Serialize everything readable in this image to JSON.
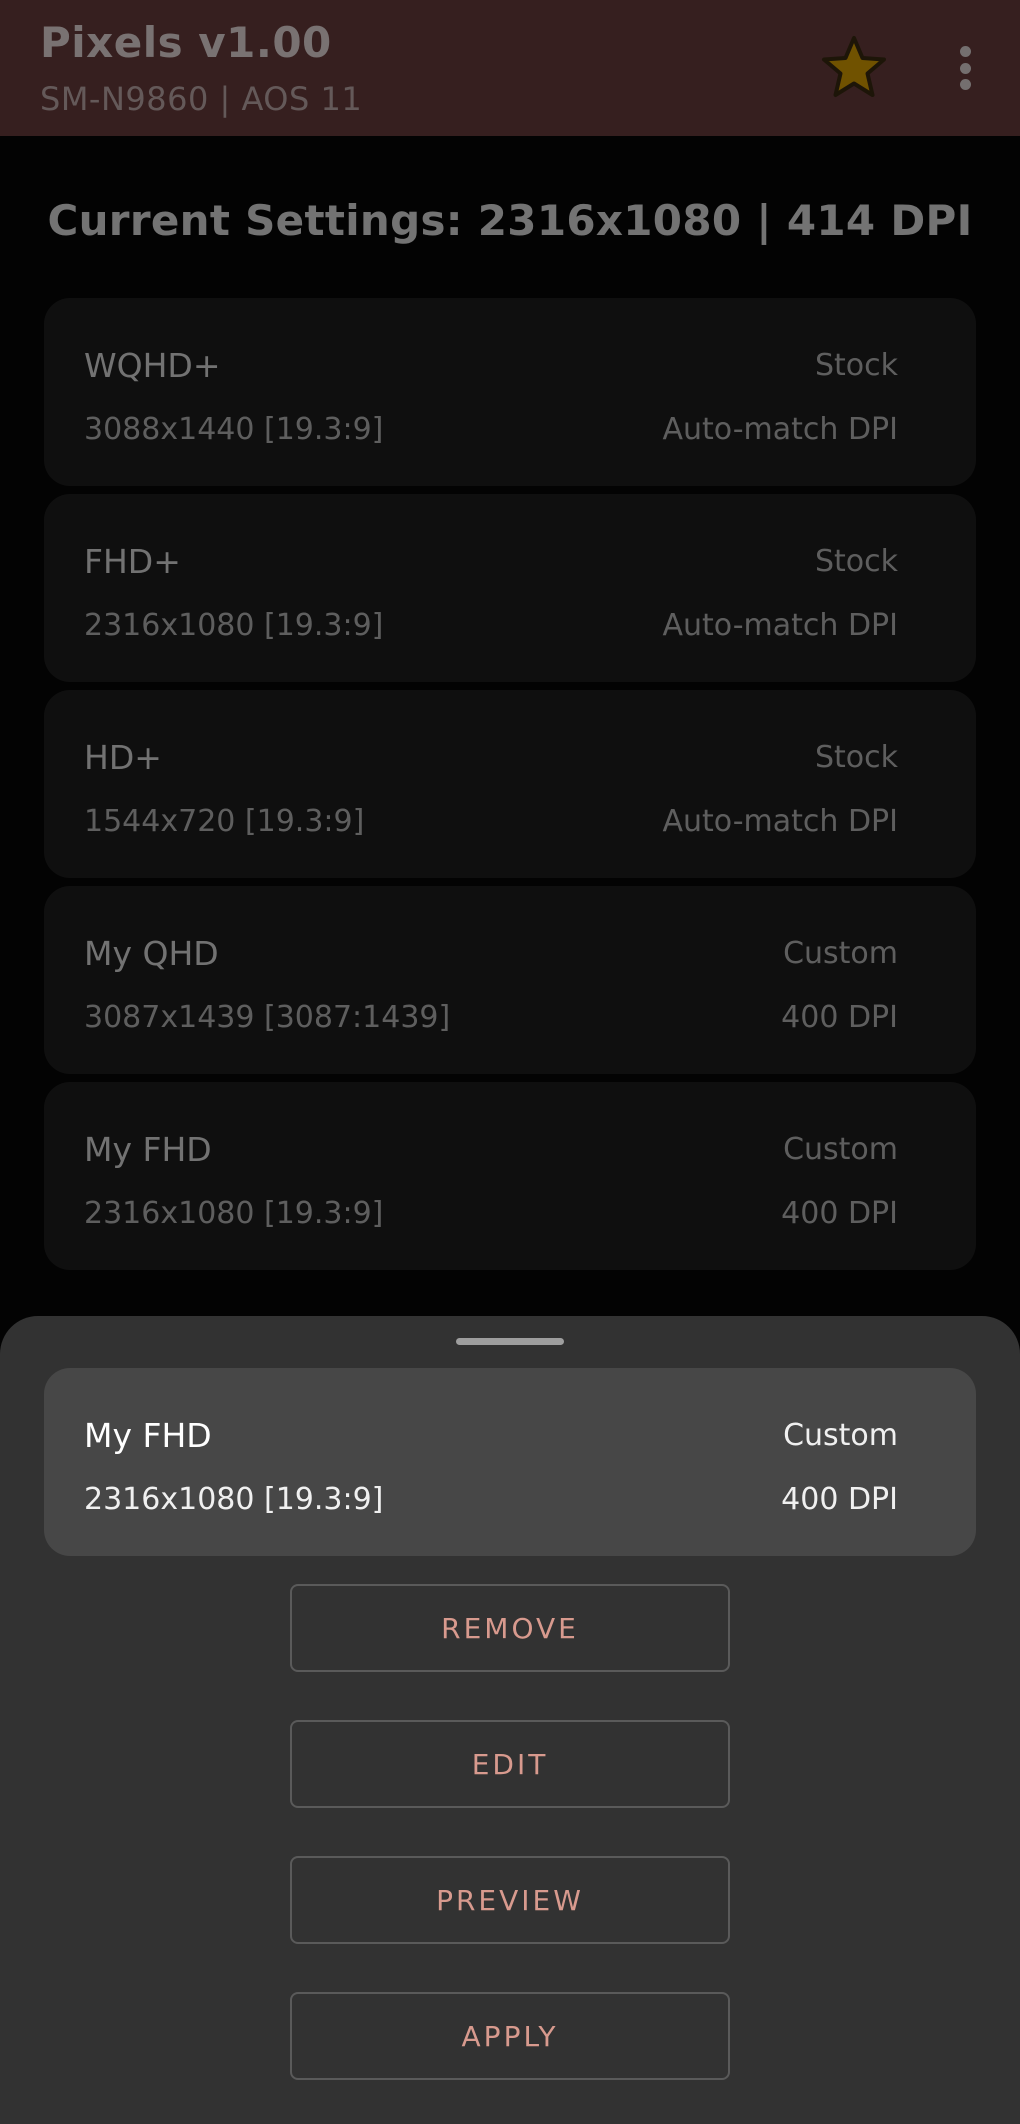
{
  "appbar": {
    "title": "Pixels v1.00",
    "subtitle": "SM-N9860 | AOS 11",
    "star_icon": "star-icon",
    "menu_icon": "more-vert-icon"
  },
  "current_settings": "Current Settings: 2316x1080 | 414 DPI",
  "profiles": [
    {
      "name": "WQHD+",
      "type": "Stock",
      "resolution": "3088x1440 [19.3:9]",
      "dpi": "Auto-match DPI"
    },
    {
      "name": "FHD+",
      "type": "Stock",
      "resolution": "2316x1080 [19.3:9]",
      "dpi": "Auto-match DPI"
    },
    {
      "name": "HD+",
      "type": "Stock",
      "resolution": "1544x720 [19.3:9]",
      "dpi": "Auto-match DPI"
    },
    {
      "name": "My QHD",
      "type": "Custom",
      "resolution": "3087x1439 [3087:1439]",
      "dpi": "400 DPI"
    },
    {
      "name": "My FHD",
      "type": "Custom",
      "resolution": "2316x1080 [19.3:9]",
      "dpi": "400 DPI"
    }
  ],
  "sheet": {
    "selected": {
      "name": "My FHD",
      "type": "Custom",
      "resolution": "2316x1080 [19.3:9]",
      "dpi": "400 DPI"
    },
    "buttons": {
      "remove": "REMOVE",
      "edit": "EDIT",
      "preview": "PREVIEW",
      "apply": "APPLY"
    }
  },
  "colors": {
    "appbar": "#6c3e3e",
    "accent_text": "#d89a8e",
    "star": "#e0a400"
  }
}
